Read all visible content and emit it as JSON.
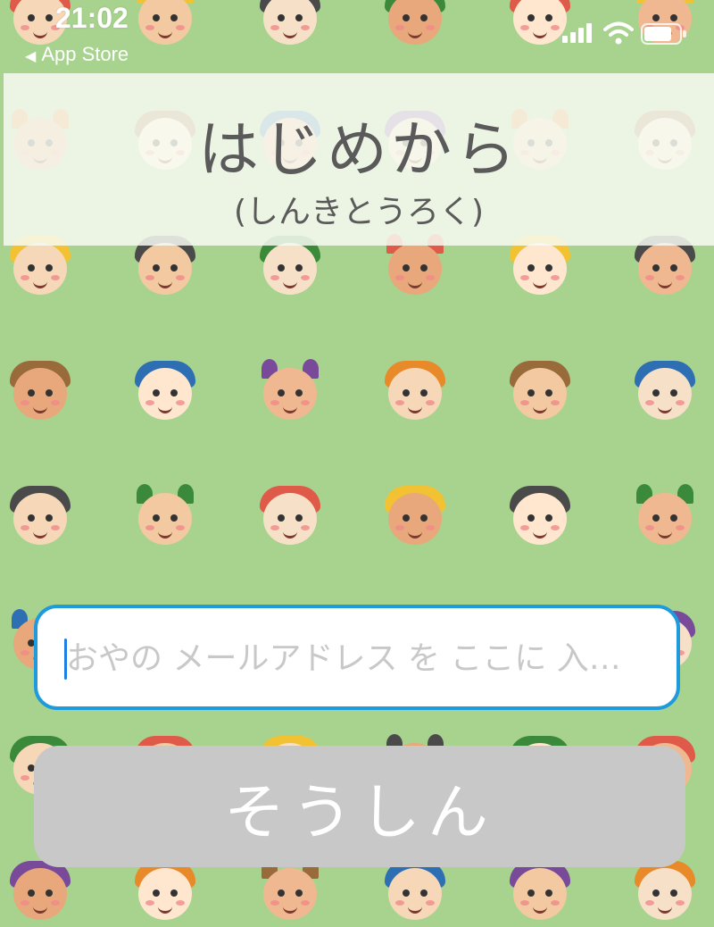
{
  "status_bar": {
    "time": "21:02",
    "back_label": "App Store",
    "back_icon": "triangle-left-icon"
  },
  "title": {
    "main": "はじめから",
    "sub": "(しんきとうろく)"
  },
  "email": {
    "value": "",
    "placeholder": "おやの メールアドレス を ここに 入…"
  },
  "send_button": {
    "label": "そうしん",
    "state": "disabled"
  },
  "colors": {
    "background": "#a8d38e",
    "input_border": "#1d9bdc",
    "button_disabled": "#c8c8c8",
    "title_text": "#5a5a5a"
  }
}
